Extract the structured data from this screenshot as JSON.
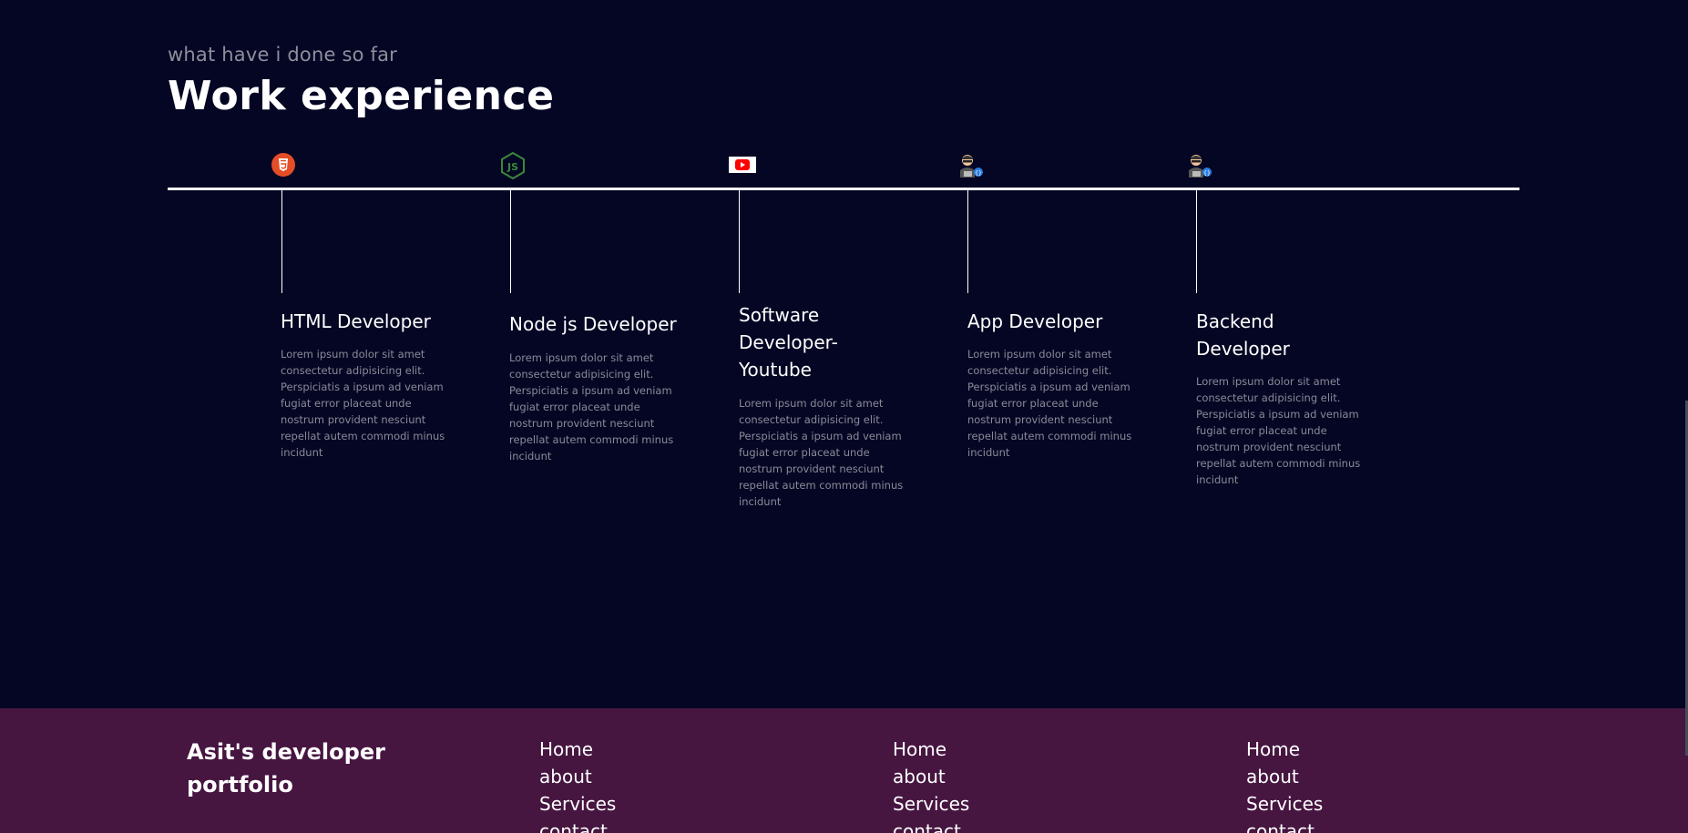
{
  "section": {
    "subtitle": "what have i done so far",
    "heading": "Work experience"
  },
  "experiences": [
    {
      "icon": "html5-icon",
      "title": "HTML Developer",
      "description": "Lorem ipsum dolor sit amet consectetur adipisicing elit. Perspiciatis a ipsum ad veniam fugiat error placeat unde nostrum provident nesciunt repellat autem commodi minus incidunt"
    },
    {
      "icon": "nodejs-icon",
      "title": "Node js Developer",
      "description": "Lorem ipsum dolor sit amet consectetur adipisicing elit. Perspiciatis a ipsum ad veniam fugiat error placeat unde nostrum provident nesciunt repellat autem commodi minus incidunt"
    },
    {
      "icon": "youtube-icon",
      "title": "Software Developer-Youtube",
      "description": "Lorem ipsum dolor sit amet consectetur adipisicing elit. Perspiciatis a ipsum ad veniam fugiat error placeat unde nostrum provident nesciunt repellat autem commodi minus incidunt"
    },
    {
      "icon": "developer-avatar-icon",
      "title": "App Developer",
      "description": "Lorem ipsum dolor sit amet consectetur adipisicing elit. Perspiciatis a ipsum ad veniam fugiat error placeat unde nostrum provident nesciunt repellat autem commodi minus incidunt"
    },
    {
      "icon": "developer-avatar-icon",
      "title": "Backend Developer",
      "description": "Lorem ipsum dolor sit amet consectetur adipisicing elit. Perspiciatis a ipsum ad veniam fugiat error placeat unde nostrum provident nesciunt repellat autem commodi minus incidunt"
    }
  ],
  "footer": {
    "brand": "Asit's developer portfolio",
    "columns": [
      {
        "links": [
          "Home",
          "about",
          "Services",
          "contact"
        ]
      },
      {
        "links": [
          "Home",
          "about",
          "Services",
          "contact"
        ]
      },
      {
        "links": [
          "Home",
          "about",
          "Services",
          "contact"
        ]
      }
    ]
  },
  "colors": {
    "background": "#050624",
    "footer_background": "#461641",
    "html5_orange": "#e44d26",
    "node_green": "#3c873a",
    "youtube_red": "#ff0000",
    "muted_text": "#8a8a98"
  }
}
